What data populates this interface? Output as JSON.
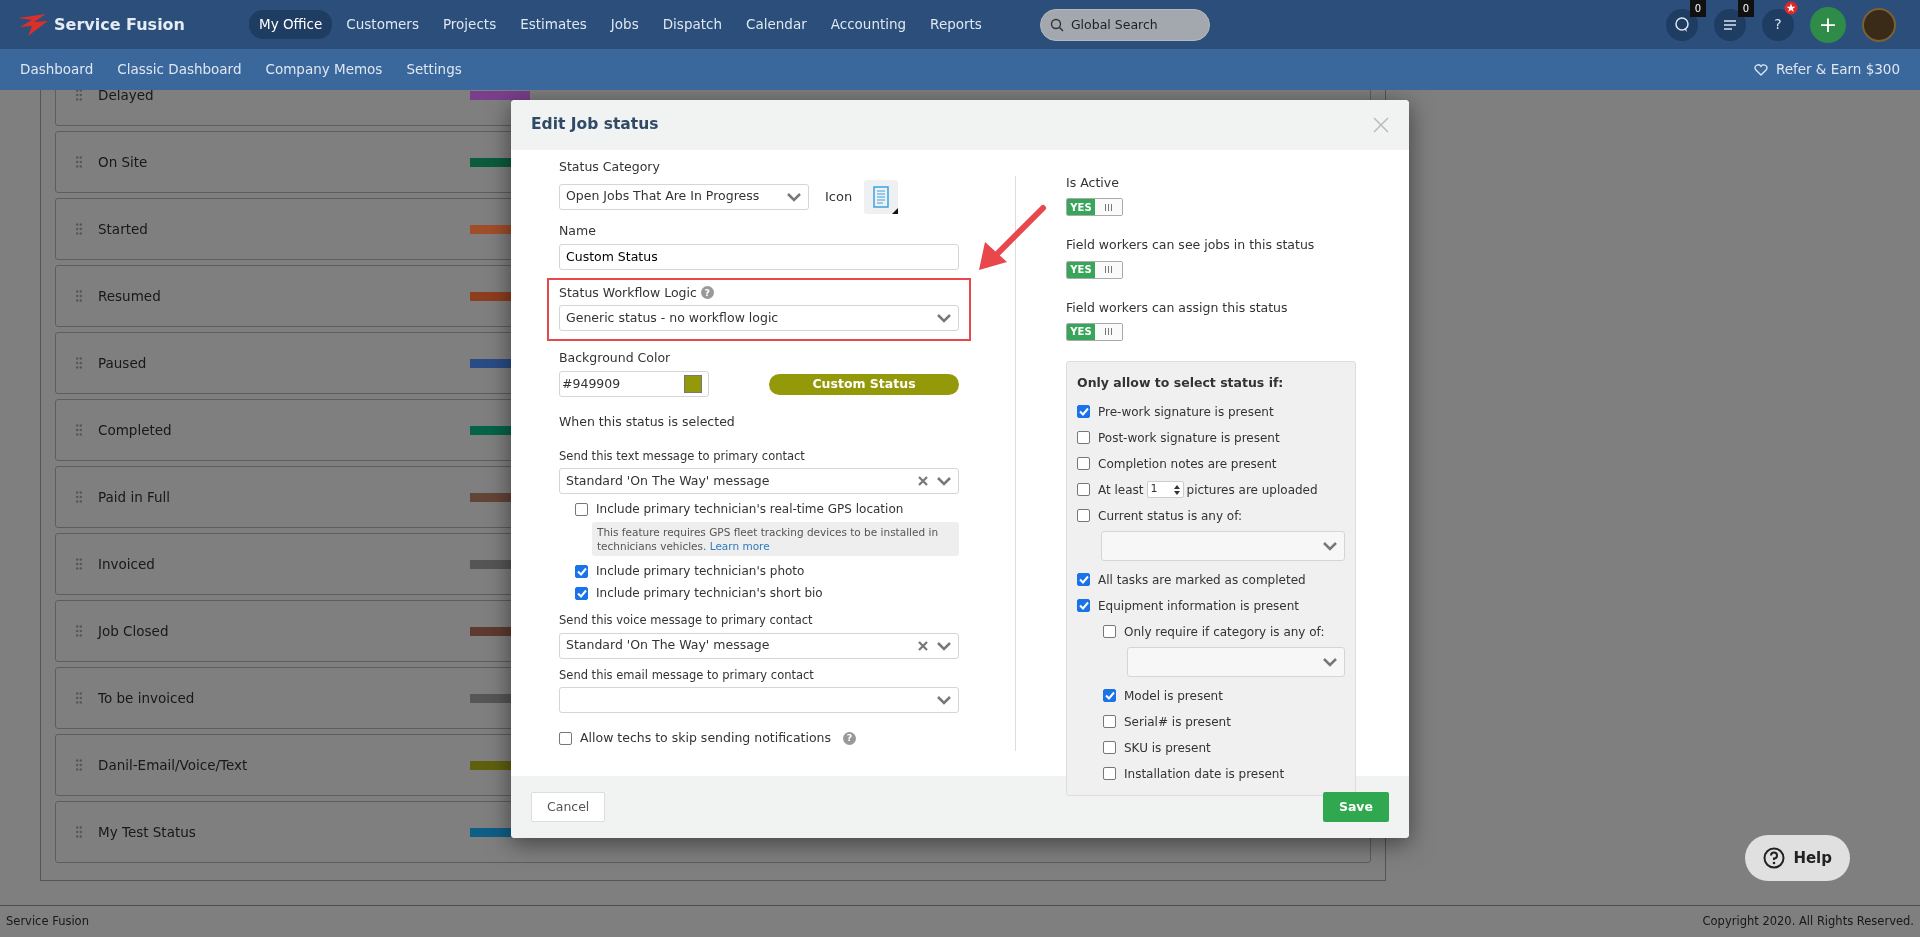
{
  "app": {
    "brand": "Service Fusion",
    "nav": [
      {
        "label": "My Office",
        "selected": true
      },
      {
        "label": "Customers",
        "selected": false
      },
      {
        "label": "Projects",
        "selected": false
      },
      {
        "label": "Estimates",
        "selected": false
      },
      {
        "label": "Jobs",
        "selected": false
      },
      {
        "label": "Dispatch",
        "selected": false
      },
      {
        "label": "Calendar",
        "selected": false
      },
      {
        "label": "Accounting",
        "selected": false
      },
      {
        "label": "Reports",
        "selected": false
      }
    ],
    "search": {
      "placeholder": "Global Search"
    },
    "chat_count": "0",
    "tasks_count": "0",
    "help_mark": "?",
    "add_mark": "+",
    "subnav": [
      "Dashboard",
      "Classic Dashboard",
      "Company Memos",
      "Settings"
    ],
    "refer": "Refer & Earn $300"
  },
  "status_list": [
    {
      "name": "Delayed",
      "color": "#7a3f8c"
    },
    {
      "name": "On Site",
      "color": "#0a5c3c"
    },
    {
      "name": "Started",
      "color": "#a04e2a"
    },
    {
      "name": "Resumed",
      "color": "#8d3e1e"
    },
    {
      "name": "Paused",
      "color": "#2a4c86"
    },
    {
      "name": "Completed",
      "color": "#056448"
    },
    {
      "name": "Paid in Full",
      "color": "#634438"
    },
    {
      "name": "Invoiced",
      "color": "#555555"
    },
    {
      "name": "Job Closed",
      "color": "#5e3a30"
    },
    {
      "name": "To be invoiced",
      "color": "#565656"
    },
    {
      "name": "Danil-Email/Voice/Text",
      "color": "#5f600e"
    },
    {
      "name": "My Test Status",
      "color": "#0e5e86"
    }
  ],
  "modal": {
    "title": "Edit Job status",
    "status_category": {
      "label": "Status Category",
      "value": "Open Jobs That Are In Progress"
    },
    "icon_label": "Icon",
    "name": {
      "label": "Name",
      "value": "Custom Status"
    },
    "workflow": {
      "label": "Status Workflow Logic",
      "help": "?",
      "value": "Generic status - no workflow logic",
      "highlighted": true
    },
    "background_color": {
      "label": "Background Color",
      "value": "#949909",
      "preview": "Custom Status"
    },
    "section": "When this status is selected",
    "text_message": {
      "label": "Send this text message to primary contact",
      "value": "Standard 'On The Way' message",
      "clearable": true
    },
    "text_options": [
      {
        "label": "Include primary technician's real-time GPS location",
        "checked": false,
        "note": "This feature requires GPS fleet tracking devices to be installed in technicians vehicles.",
        "note_link": "Learn more"
      },
      {
        "label": "Include primary technician's photo",
        "checked": true
      },
      {
        "label": "Include primary technician's short bio",
        "checked": true
      }
    ],
    "voice_message": {
      "label": "Send this voice message to primary contact",
      "value": "Standard 'On The Way' message",
      "clearable": true
    },
    "email_message": {
      "label": "Send this email message to primary contact",
      "clearable": false
    },
    "allow_skip": {
      "label": "Allow techs to skip sending notifications",
      "checked": false,
      "help": "?"
    },
    "toggles": [
      {
        "label": "Is Active",
        "on": true,
        "text": "YES"
      },
      {
        "label": "Field workers can see jobs in this status",
        "on": true,
        "text": "YES"
      },
      {
        "label": "Field workers can assign this status",
        "on": true,
        "text": "YES"
      }
    ],
    "conditions": {
      "title": "Only allow to select status if:",
      "items": [
        {
          "kind": "check",
          "label": "Pre-work signature is present",
          "checked": true
        },
        {
          "kind": "check",
          "label": "Post-work signature is present",
          "checked": false
        },
        {
          "kind": "check",
          "label": "Completion notes are present",
          "checked": false
        },
        {
          "kind": "count",
          "prefix": "At least",
          "count": "1",
          "label": "pictures are uploaded",
          "checked": false
        },
        {
          "kind": "select",
          "label": "Current status is any of:",
          "checked": false
        },
        {
          "kind": "check",
          "label": "All tasks are marked as completed",
          "checked": true
        },
        {
          "kind": "check",
          "label": "Equipment information is present",
          "checked": true,
          "children": [
            {
              "kind": "select",
              "label": "Only require if category is any of:",
              "checked": false
            },
            {
              "kind": "check",
              "label": "Model is present",
              "checked": true
            },
            {
              "kind": "check",
              "label": "Serial# is present",
              "checked": false
            },
            {
              "kind": "check",
              "label": "SKU is present",
              "checked": false
            },
            {
              "kind": "check",
              "label": "Installation date is present",
              "checked": false
            }
          ]
        }
      ]
    },
    "buttons": {
      "cancel": "Cancel",
      "save": "Save"
    }
  },
  "footer": {
    "left": "Service Fusion",
    "right": "Copyright 2020. All Rights Reserved."
  },
  "help_button": "Help"
}
